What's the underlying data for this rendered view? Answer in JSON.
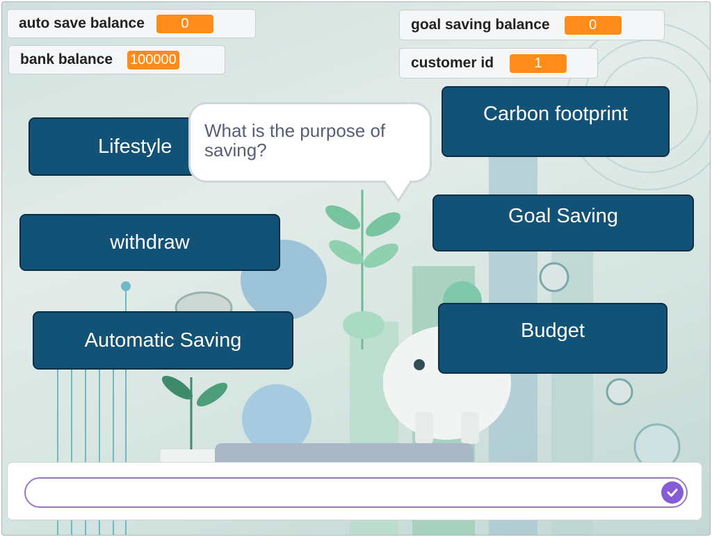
{
  "monitors": {
    "auto_save": {
      "label": "auto save balance",
      "value": "0"
    },
    "bank": {
      "label": "bank balance",
      "value": "100000"
    },
    "goal_saving": {
      "label": "goal saving balance",
      "value": "0"
    },
    "customer_id": {
      "label": "customer id",
      "value": "1"
    }
  },
  "buttons": {
    "lifestyle": "Lifestyle",
    "withdraw": "withdraw",
    "automatic_saving": "Automatic Saving",
    "carbon_footprint": "Carbon footprint",
    "goal_saving": "Goal Saving",
    "budget": "Budget"
  },
  "speech_bubble": {
    "text": "What is the purpose of saving?"
  },
  "ask": {
    "value": "",
    "placeholder": ""
  },
  "colors": {
    "button": "#125277",
    "monitor_value": "#ff8c1a",
    "submit": "#855cd6"
  },
  "icons": {
    "submit": "check-icon"
  }
}
